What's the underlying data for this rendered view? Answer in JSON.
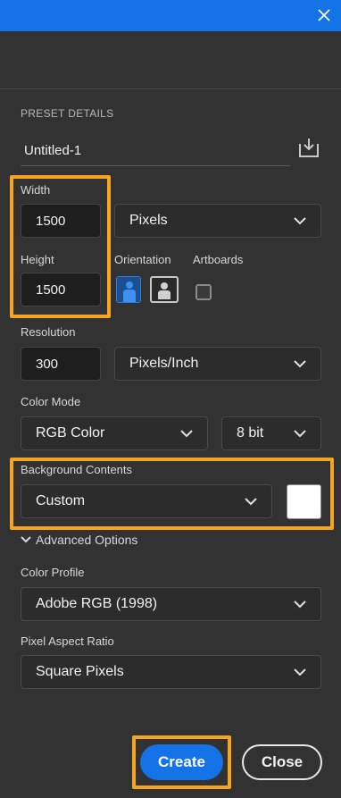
{
  "header": {
    "close_icon": "close-icon"
  },
  "preset": {
    "section_title": "PRESET DETAILS",
    "name_value": "Untitled-1",
    "save_icon": "save-preset-icon"
  },
  "dimensions": {
    "width_label": "Width",
    "width_value": "1500",
    "unit_selected": "Pixels",
    "height_label": "Height",
    "height_value": "1500",
    "orientation_label": "Orientation",
    "artboards_label": "Artboards"
  },
  "resolution": {
    "label": "Resolution",
    "value": "300",
    "unit_selected": "Pixels/Inch"
  },
  "color_mode": {
    "label": "Color Mode",
    "mode_selected": "RGB Color",
    "depth_selected": "8 bit"
  },
  "background": {
    "label": "Background Contents",
    "selected": "Custom",
    "swatch_color": "#ffffff"
  },
  "advanced": {
    "toggle_label": "Advanced Options",
    "color_profile_label": "Color Profile",
    "color_profile_selected": "Adobe RGB (1998)",
    "pixel_aspect_label": "Pixel Aspect Ratio",
    "pixel_aspect_selected": "Square Pixels"
  },
  "actions": {
    "create_label": "Create",
    "close_label": "Close"
  },
  "colors": {
    "accent": "#1473e6",
    "highlight": "#f7a51c",
    "panel_bg": "#323232"
  }
}
